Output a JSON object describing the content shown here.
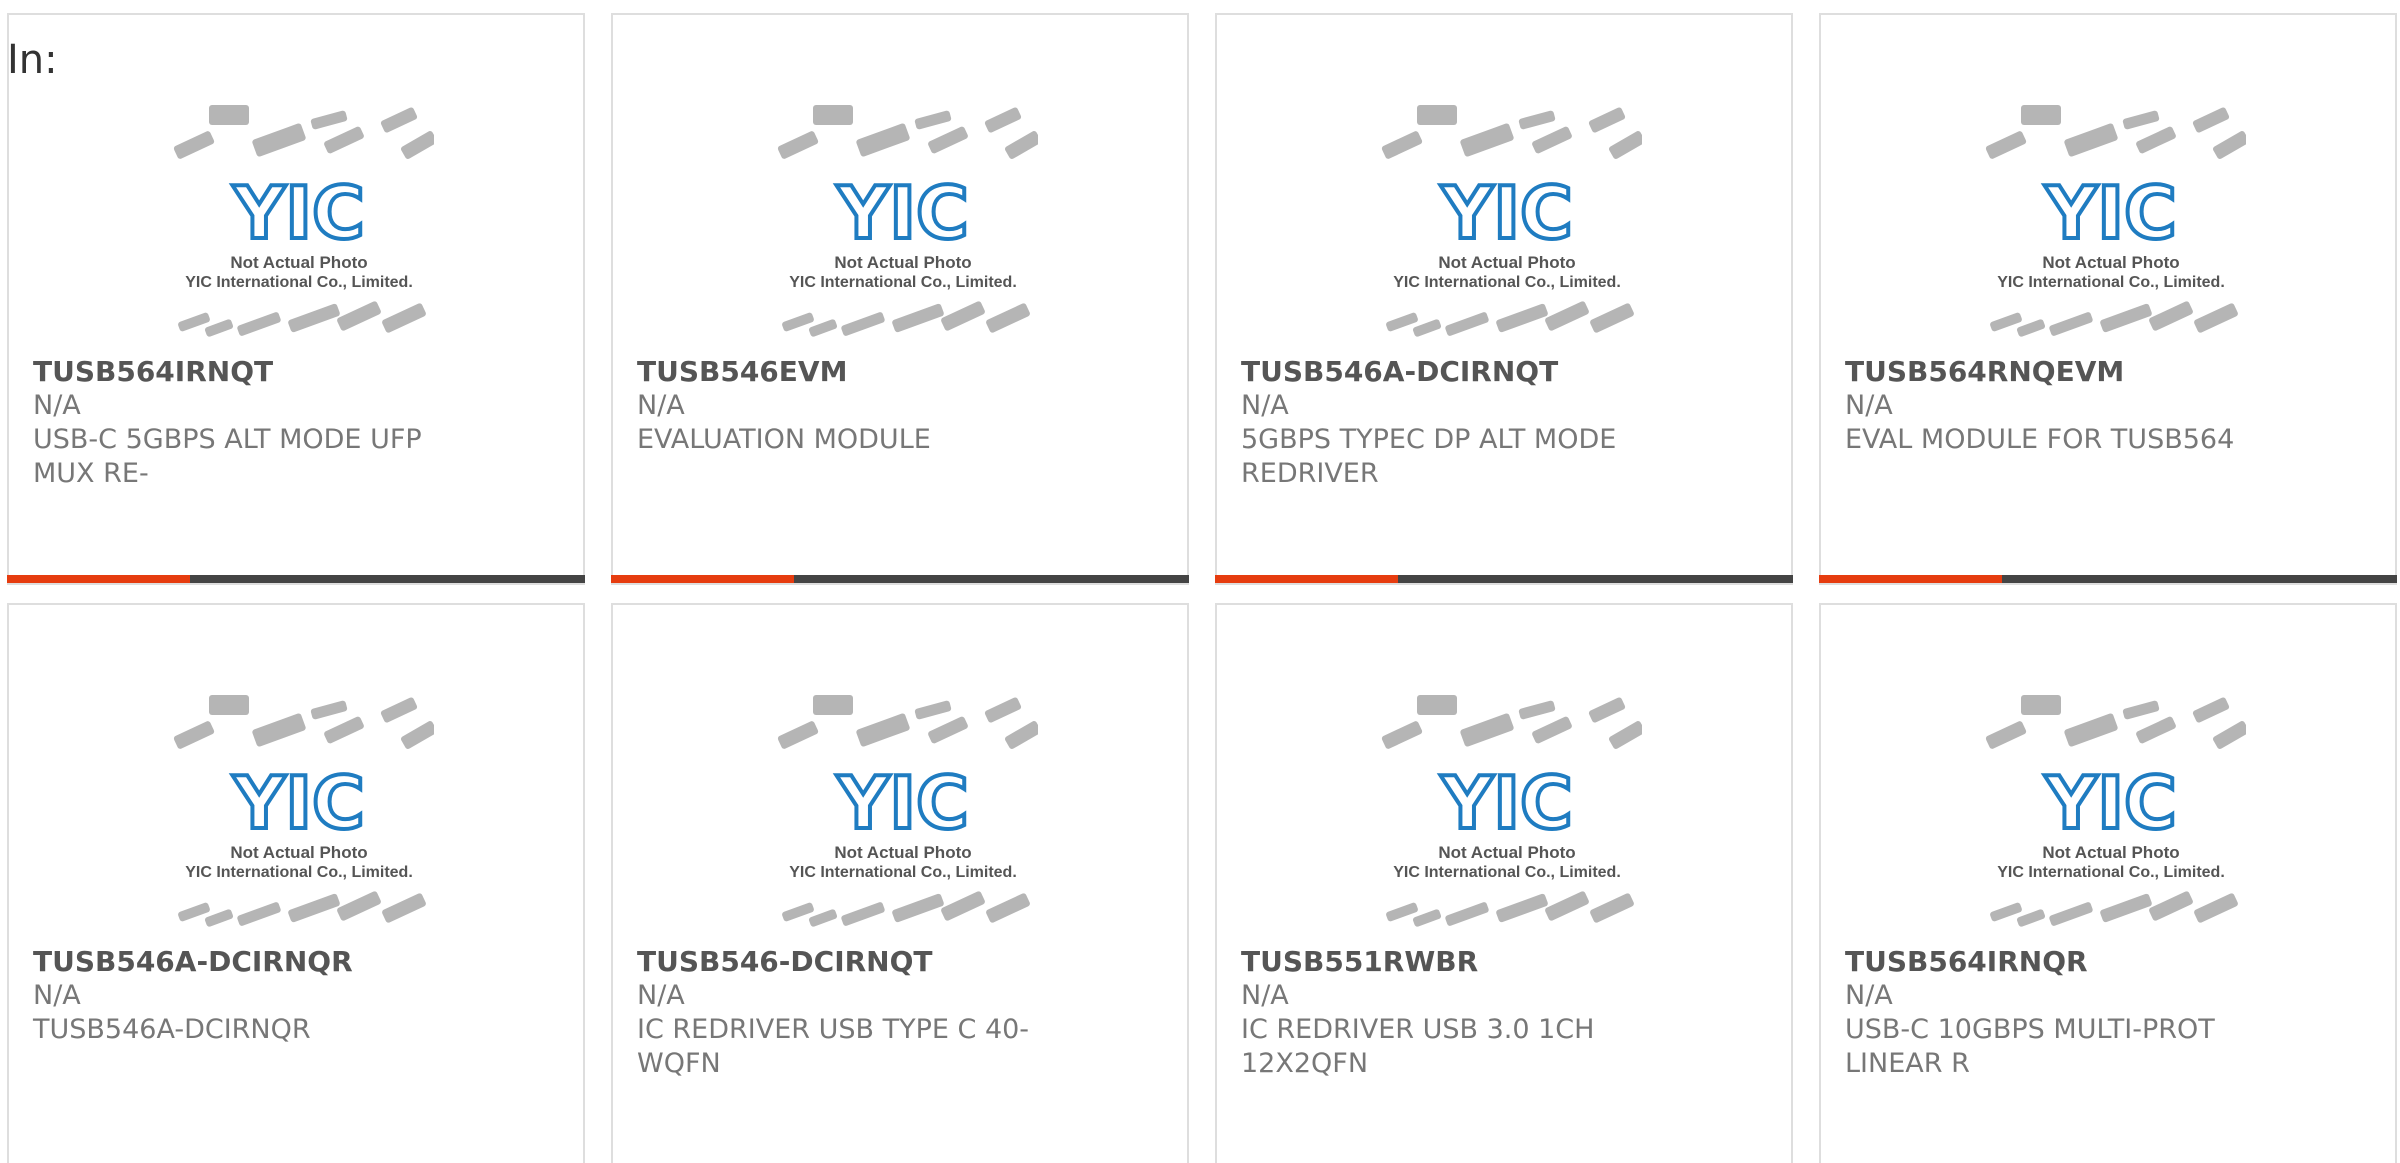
{
  "filter": {
    "label": "In:"
  },
  "placeholder_photo": {
    "logo_text": "YIC",
    "line1": "Not Actual Photo",
    "line2": "YIC International Co., Limited.",
    "logo_color": "#1f7cc1",
    "chip_color": "#b5b5b5"
  },
  "accent_color": "#e63c0f",
  "products": [
    {
      "part": "TUSB564IRNQT",
      "manufacturer": "N/A",
      "description": "USB-C 5GBPS ALT MODE UFP MUX RE-"
    },
    {
      "part": "TUSB546EVM",
      "manufacturer": "N/A",
      "description": "EVALUATION MODULE"
    },
    {
      "part": "TUSB546A-DCIRNQT",
      "manufacturer": "N/A",
      "description": "5GBPS TYPEC DP ALT MODE REDRIVER"
    },
    {
      "part": "TUSB564RNQEVM",
      "manufacturer": "N/A",
      "description": "EVAL MODULE FOR TUSB564"
    },
    {
      "part": "TUSB546A-DCIRNQR",
      "manufacturer": "N/A",
      "description": "TUSB546A-DCIRNQR"
    },
    {
      "part": "TUSB546-DCIRNQT",
      "manufacturer": "N/A",
      "description": "IC REDRIVER USB TYPE C 40-WQFN"
    },
    {
      "part": "TUSB551RWBR",
      "manufacturer": "N/A",
      "description": "IC REDRIVER USB 3.0 1CH 12X2QFN"
    },
    {
      "part": "TUSB564IRNQR",
      "manufacturer": "N/A",
      "description": "USB-C 10GBPS MULTI-PROT LINEAR R"
    }
  ]
}
